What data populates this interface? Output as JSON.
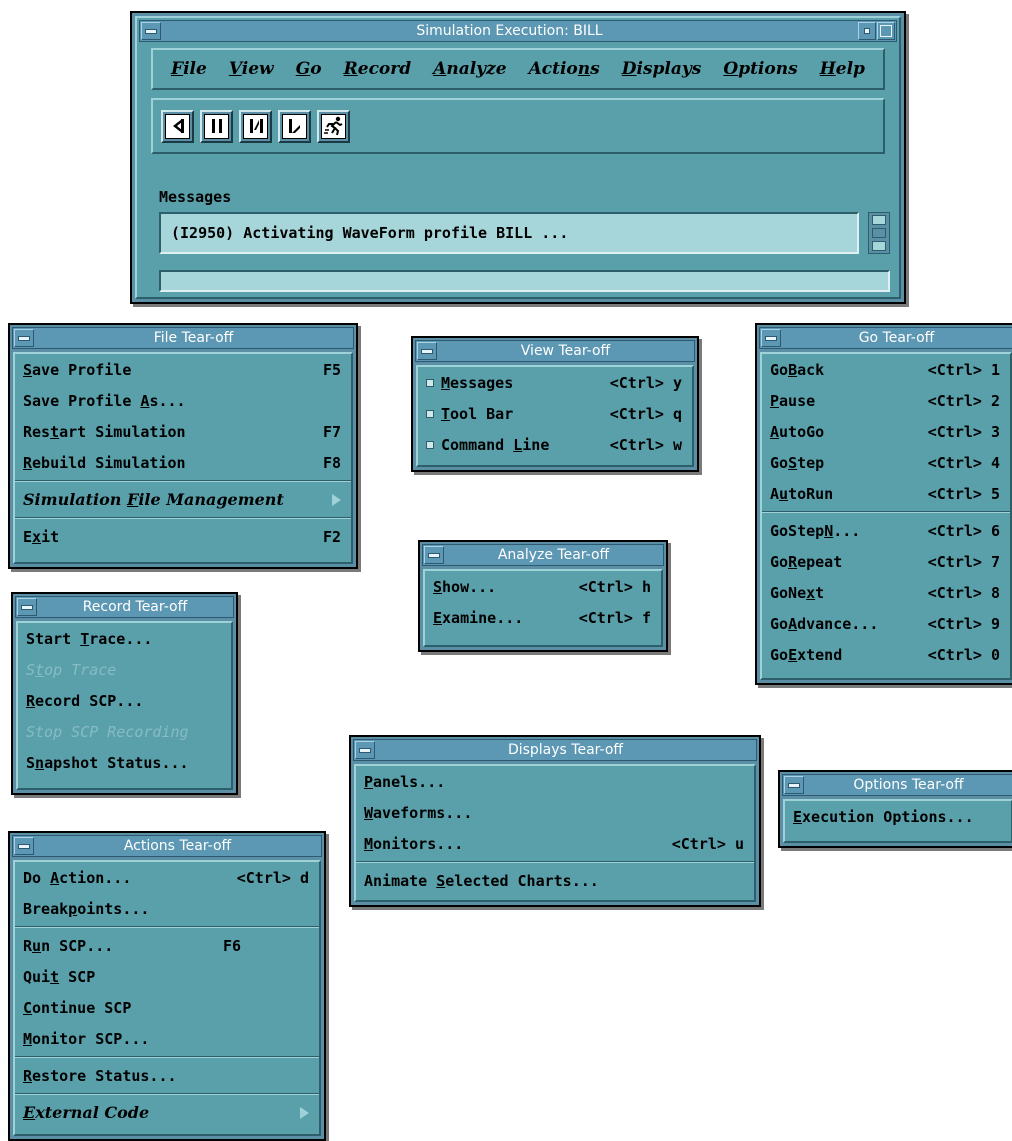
{
  "main": {
    "title": "Simulation Execution: BILL",
    "menus": [
      {
        "label": "File",
        "mn": "F",
        "rest": "ile"
      },
      {
        "label": "View",
        "mn": "V",
        "rest": "iew"
      },
      {
        "label": "Go",
        "mn": "G",
        "rest": "o"
      },
      {
        "label": "Record",
        "mn": "R",
        "rest": "ecord"
      },
      {
        "label": "Analyze",
        "mn": "A",
        "rest": "nalyze"
      },
      {
        "label": "Actions",
        "pre": "Actio",
        "mn": "n",
        "rest": "s"
      },
      {
        "label": "Displays",
        "mn": "D",
        "rest": "isplays"
      },
      {
        "label": "Options",
        "mn": "O",
        "rest": "ptions"
      },
      {
        "label": "Help",
        "mn": "H",
        "rest": "elp"
      }
    ],
    "tools": [
      "go-back-tool",
      "pause-tool",
      "step-tool",
      "go-tool",
      "auto-run-tool"
    ],
    "messages_label": "Messages",
    "message_text": "(I2950) Activating WaveForm profile BILL ...",
    "command_value": ""
  },
  "file": {
    "title": "File Tear-off",
    "items": [
      {
        "pre": "",
        "mn": "S",
        "post": "ave Profile",
        "acc": "F5"
      },
      {
        "pre": "Save Profile ",
        "mn": "A",
        "post": "s...",
        "acc": ""
      },
      {
        "pre": "Res",
        "mn": "t",
        "post": "art Simulation",
        "acc": "F7"
      },
      {
        "pre": "",
        "mn": "R",
        "post": "ebuild Simulation",
        "acc": "F8"
      },
      {
        "pre": "Simulation ",
        "mn": "F",
        "post": "ile Management",
        "acc": ""
      },
      {
        "pre": "E",
        "mn": "x",
        "post": "it",
        "acc": "F2"
      }
    ]
  },
  "view": {
    "title": "View Tear-off",
    "items": [
      {
        "pre": "",
        "mn": "M",
        "post": "essages",
        "acc": "<Ctrl> y"
      },
      {
        "pre": "",
        "mn": "T",
        "post": "ool Bar",
        "acc": "<Ctrl> q"
      },
      {
        "pre": "Command ",
        "mn": "L",
        "post": "ine",
        "acc": "<Ctrl> w"
      }
    ]
  },
  "go": {
    "title": "Go Tear-off",
    "items": [
      {
        "pre": "Go",
        "mn": "B",
        "post": "ack",
        "acc": "<Ctrl> 1"
      },
      {
        "pre": "",
        "mn": "P",
        "post": "ause",
        "acc": "<Ctrl> 2"
      },
      {
        "pre": "",
        "mn": "A",
        "post": "utoGo",
        "acc": "<Ctrl> 3"
      },
      {
        "pre": "Go",
        "mn": "S",
        "post": "tep",
        "acc": "<Ctrl> 4"
      },
      {
        "pre": "A",
        "mn": "u",
        "post": "toRun",
        "acc": "<Ctrl> 5"
      },
      {
        "pre": "GoStep",
        "mn": "N",
        "post": "...",
        "acc": "<Ctrl> 6"
      },
      {
        "pre": "Go",
        "mn": "R",
        "post": "epeat",
        "acc": "<Ctrl> 7"
      },
      {
        "pre": "GoNe",
        "mn": "x",
        "post": "t",
        "acc": "<Ctrl> 8"
      },
      {
        "pre": "Go",
        "mn": "A",
        "post": "dvance...",
        "acc": "<Ctrl> 9"
      },
      {
        "pre": "Go",
        "mn": "E",
        "post": "xtend",
        "acc": "<Ctrl> 0"
      }
    ]
  },
  "analyze": {
    "title": "Analyze Tear-off",
    "items": [
      {
        "pre": "",
        "mn": "S",
        "post": "how...",
        "acc": "<Ctrl> h"
      },
      {
        "pre": "",
        "mn": "E",
        "post": "xamine...",
        "acc": "<Ctrl> f"
      }
    ]
  },
  "record": {
    "title": "Record Tear-off",
    "items": [
      {
        "pre": "Start ",
        "mn": "T",
        "post": "race...",
        "acc": ""
      },
      {
        "pre": "S",
        "mn": "t",
        "post": "op Trace",
        "acc": ""
      },
      {
        "pre": "",
        "mn": "R",
        "post": "ecord SCP...",
        "acc": ""
      },
      {
        "pre": "Stop SCP Recording",
        "mn": "",
        "post": "",
        "acc": ""
      },
      {
        "pre": "S",
        "mn": "n",
        "post": "apshot Status...",
        "acc": ""
      }
    ]
  },
  "displays": {
    "title": "Displays Tear-off",
    "items": [
      {
        "pre": "",
        "mn": "P",
        "post": "anels...",
        "acc": ""
      },
      {
        "pre": "",
        "mn": "W",
        "post": "aveforms...",
        "acc": ""
      },
      {
        "pre": "",
        "mn": "M",
        "post": "onitors...",
        "acc": "<Ctrl> u"
      },
      {
        "pre": "Animate ",
        "mn": "S",
        "post": "elected Charts...",
        "acc": ""
      }
    ]
  },
  "options": {
    "title": "Options Tear-off",
    "items": [
      {
        "pre": "",
        "mn": "E",
        "post": "xecution Options...",
        "acc": ""
      }
    ]
  },
  "actions": {
    "title": "Actions Tear-off",
    "items": [
      {
        "pre": "Do ",
        "mn": "A",
        "post": "ction...",
        "acc": "<Ctrl> d"
      },
      {
        "pre": "Break",
        "mn": "p",
        "post": "oints...",
        "acc": ""
      },
      {
        "pre": "R",
        "mn": "u",
        "post": "n SCP...",
        "acc": "F6"
      },
      {
        "pre": "Qui",
        "mn": "t",
        "post": " SCP",
        "acc": ""
      },
      {
        "pre": "",
        "mn": "C",
        "post": "ontinue SCP",
        "acc": ""
      },
      {
        "pre": "",
        "mn": "M",
        "post": "onitor SCP...",
        "acc": ""
      },
      {
        "pre": "",
        "mn": "R",
        "post": "estore Status...",
        "acc": ""
      },
      {
        "pre": "",
        "mn": "E",
        "post": "xternal Code",
        "acc": ""
      }
    ]
  }
}
